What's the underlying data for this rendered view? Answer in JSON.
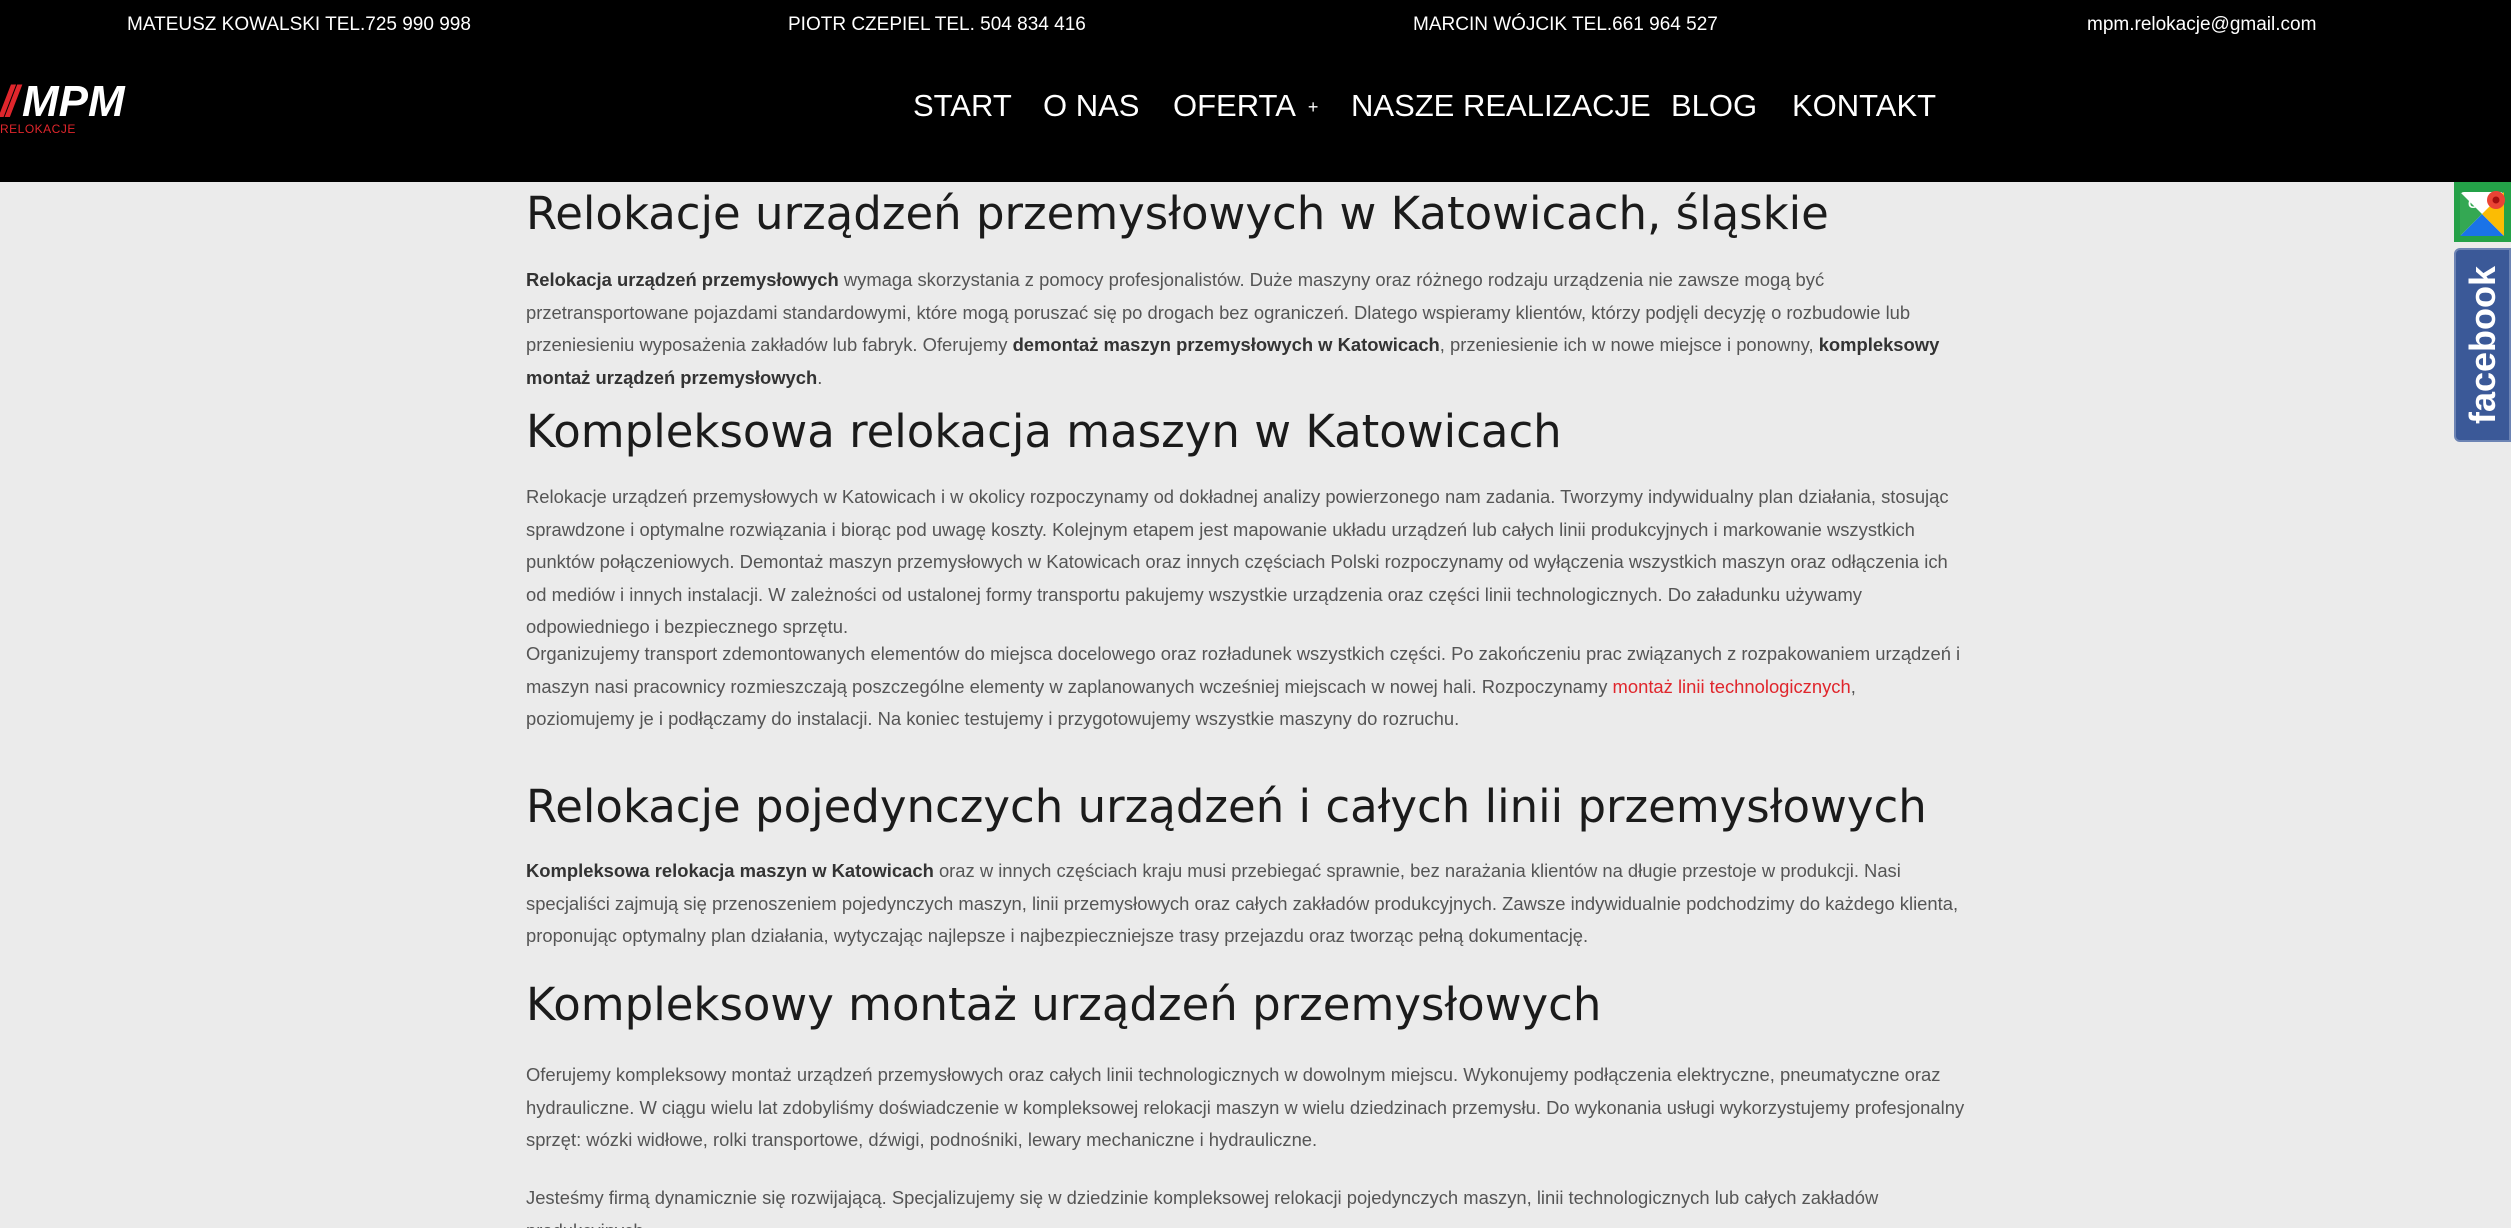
{
  "header": {
    "contacts": [
      "MATEUSZ KOWALSKI TEL.725 990 998",
      "PIOTR CZEPIEL TEL. 504 834 416",
      "MARCIN WÓJCIK TEL.661 964 527",
      "mpm.relokacje@gmail.com"
    ],
    "logo": {
      "slashes": "//",
      "name": "MPM",
      "sub": "RELOKACJE"
    },
    "nav": [
      "START",
      "O NAS",
      "OFERTA",
      "NASZE REALIZACJE",
      "BLOG",
      "KONTAKT"
    ],
    "nav_submenu_marker": "+"
  },
  "side_widgets": {
    "maps": "google-maps-icon",
    "facebook": "facebook"
  },
  "content": {
    "h1": "Relokacje urządzeń przemysłowych w Katowicach, śląskie",
    "p1": {
      "b1": "Relokacja urządzeń przemysłowych",
      "t1": " wymaga skorzystania z pomocy profesjonalistów. Duże maszyny oraz różnego rodzaju urządzenia nie zawsze mogą być przetransportowane pojazdami standardowymi, które mogą poruszać się po drogach bez ograniczeń. Dlatego wspieramy klientów, którzy podjęli decyzję o rozbudowie lub przeniesieniu wyposażenia zakładów lub fabryk. Oferujemy ",
      "b2": "demontaż maszyn przemysłowych w Katowicach",
      "t2": ", przeniesienie ich w nowe miejsce i ponowny, ",
      "b3": "kompleksowy montaż urządzeń przemysłowych",
      "t3": "."
    },
    "h2_1": "Kompleksowa relokacja maszyn w Katowicach",
    "p2": "Relokacje urządzeń przemysłowych w Katowicach i w okolicy rozpoczynamy od dokładnej analizy powierzonego nam zadania. Tworzymy indywidualny plan działania, stosując sprawdzone i optymalne rozwiązania i biorąc pod uwagę koszty. Kolejnym etapem jest mapowanie układu urządzeń lub całych linii produkcyjnych i markowanie wszystkich punktów połączeniowych. Demontaż maszyn przemysłowych w Katowicach oraz innych częściach Polski rozpoczynamy od wyłączenia wszystkich maszyn oraz odłączenia ich od mediów i innych instalacji. W zależności od ustalonej formy transportu pakujemy wszystkie urządzenia oraz części linii technologicznych. Do załadunku używamy odpowiedniego i bezpiecznego sprzętu.",
    "p3": {
      "t1": "Organizujemy transport zdemontowanych elementów do miejsca docelowego oraz rozładunek wszystkich części. Po zakończeniu prac związanych z rozpakowaniem urządzeń i maszyn nasi pracownicy rozmieszczają poszczególne elementy w zaplanowanych wcześniej miejscach w nowej hali. Rozpoczynamy ",
      "link": "montaż linii technologicznych",
      "t2": ", poziomujemy je i podłączamy do instalacji. Na koniec testujemy i przygotowujemy wszystkie maszyny do rozruchu."
    },
    "h2_2": "Relokacje pojedynczych urządzeń i całych linii przemysłowych",
    "p4": {
      "b1": "Kompleksowa relokacja maszyn w Katowicach",
      "t1": " oraz w innych częściach kraju musi przebiegać sprawnie, bez narażania klientów na długie przestoje w produkcji. Nasi specjaliści zajmują się przenoszeniem pojedynczych maszyn, linii przemysłowych oraz całych zakładów produkcyjnych. Zawsze indywidualnie podchodzimy do każdego klienta, proponując optymalny plan działania, wytyczając najlepsze i najbezpieczniejsze trasy przejazdu oraz tworząc pełną dokumentację."
    },
    "h2_3": "Kompleksowy montaż urządzeń przemysłowych",
    "p5": "Oferujemy kompleksowy montaż urządzeń przemysłowych oraz całych linii technologicznych w dowolnym miejscu. Wykonujemy podłączenia elektryczne, pneumatyczne oraz hydrauliczne. W ciągu wielu lat zdobyliśmy doświadczenie w kompleksowej relokacji maszyn w wielu dziedzinach przemysłu. Do wykonania usługi wykorzystujemy profesjonalny sprzęt: wózki widłowe, rolki transportowe, dźwigi, podnośniki, lewary mechaniczne i hydrauliczne.",
    "p6": "Jesteśmy firmą dynamicznie się rozwijającą. Specjalizujemy się w dziedzinie kompleksowej relokacji pojedynczych maszyn, linii technologicznych lub całych zakładów produkcyjnych."
  }
}
